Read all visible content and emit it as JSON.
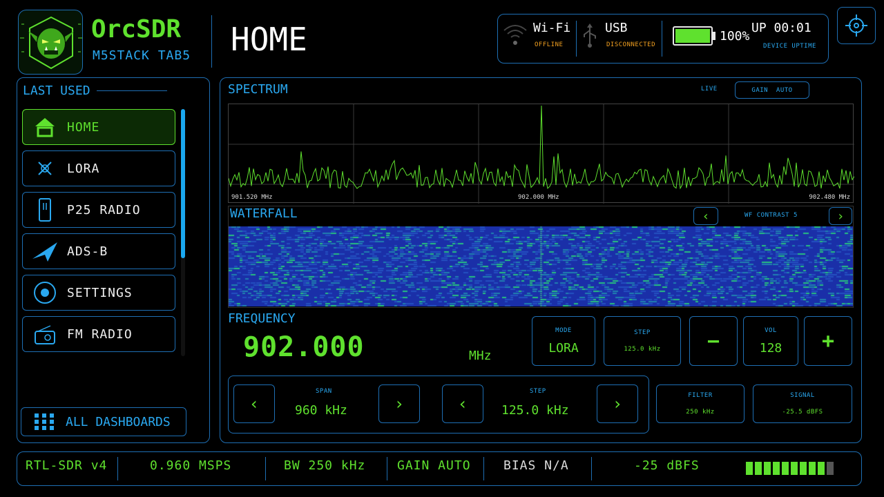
{
  "brand": {
    "name": "OrcSDR",
    "device": "M5STACK TAB5",
    "logo_icon": "orc-logo-icon"
  },
  "page_title": "HOME",
  "status": {
    "wifi": {
      "label": "Wi-Fi",
      "state": "OFFLINE",
      "icon": "wifi-icon"
    },
    "usb": {
      "label": "USB",
      "state": "DISCONNECTED",
      "icon": "usb-icon"
    },
    "battery": {
      "percent_text": "100%",
      "level": 1.0,
      "icon": "battery-icon"
    },
    "uptime": {
      "value": "UP 00:01",
      "label": "DEVICE UPTIME"
    }
  },
  "sidebar": {
    "title": "LAST USED",
    "items": [
      {
        "label": "HOME",
        "icon": "home-icon",
        "active": true
      },
      {
        "label": "LORA",
        "icon": "lora-icon"
      },
      {
        "label": "P25 RADIO",
        "icon": "radio-handheld-icon"
      },
      {
        "label": "ADS-B",
        "icon": "plane-icon"
      },
      {
        "label": "SETTINGS",
        "icon": "settings-icon"
      },
      {
        "label": "FM RADIO",
        "icon": "fm-radio-icon"
      }
    ],
    "all_dashboards": "ALL DASHBOARDS"
  },
  "spectrum": {
    "title": "SPECTRUM",
    "live": "LIVE",
    "gain": "GAIN  AUTO",
    "freq_left": "901.520 MHz",
    "freq_center": "902.000 MHz",
    "freq_right": "902.480 MHz"
  },
  "waterfall": {
    "title": "WATERFALL",
    "contrast": "WF CONTRAST 5"
  },
  "frequency": {
    "title": "FREQUENCY",
    "value": "902.000",
    "unit": "MHz"
  },
  "controls": {
    "mode": {
      "label": "MODE",
      "value": "LORA"
    },
    "step": {
      "label": "STEP",
      "value": "125.0 kHz"
    },
    "minus": "−",
    "vol": {
      "label": "VOL",
      "value": "128"
    },
    "plus": "+",
    "span": {
      "label": "SPAN",
      "value": "960 kHz"
    },
    "step2": {
      "label": "STEP",
      "value": "125.0 kHz"
    },
    "filter": {
      "label": "FILTER",
      "value": "250 kHz"
    },
    "signal": {
      "label": "SIGNAL",
      "value": "-25.5 dBFS"
    }
  },
  "footer": {
    "device": "RTL-SDR v4",
    "rate": "0.960 MSPS",
    "bw": "BW 250 kHz",
    "gain": "GAIN AUTO",
    "bias": "BIAS N/A",
    "dbfs": "-25 dBFS",
    "signal_level": 0.9
  },
  "colors": {
    "accent": "#5fe12e",
    "frame": "#1e6fb4",
    "label": "#2aa8f0",
    "warn": "#f2a020"
  }
}
